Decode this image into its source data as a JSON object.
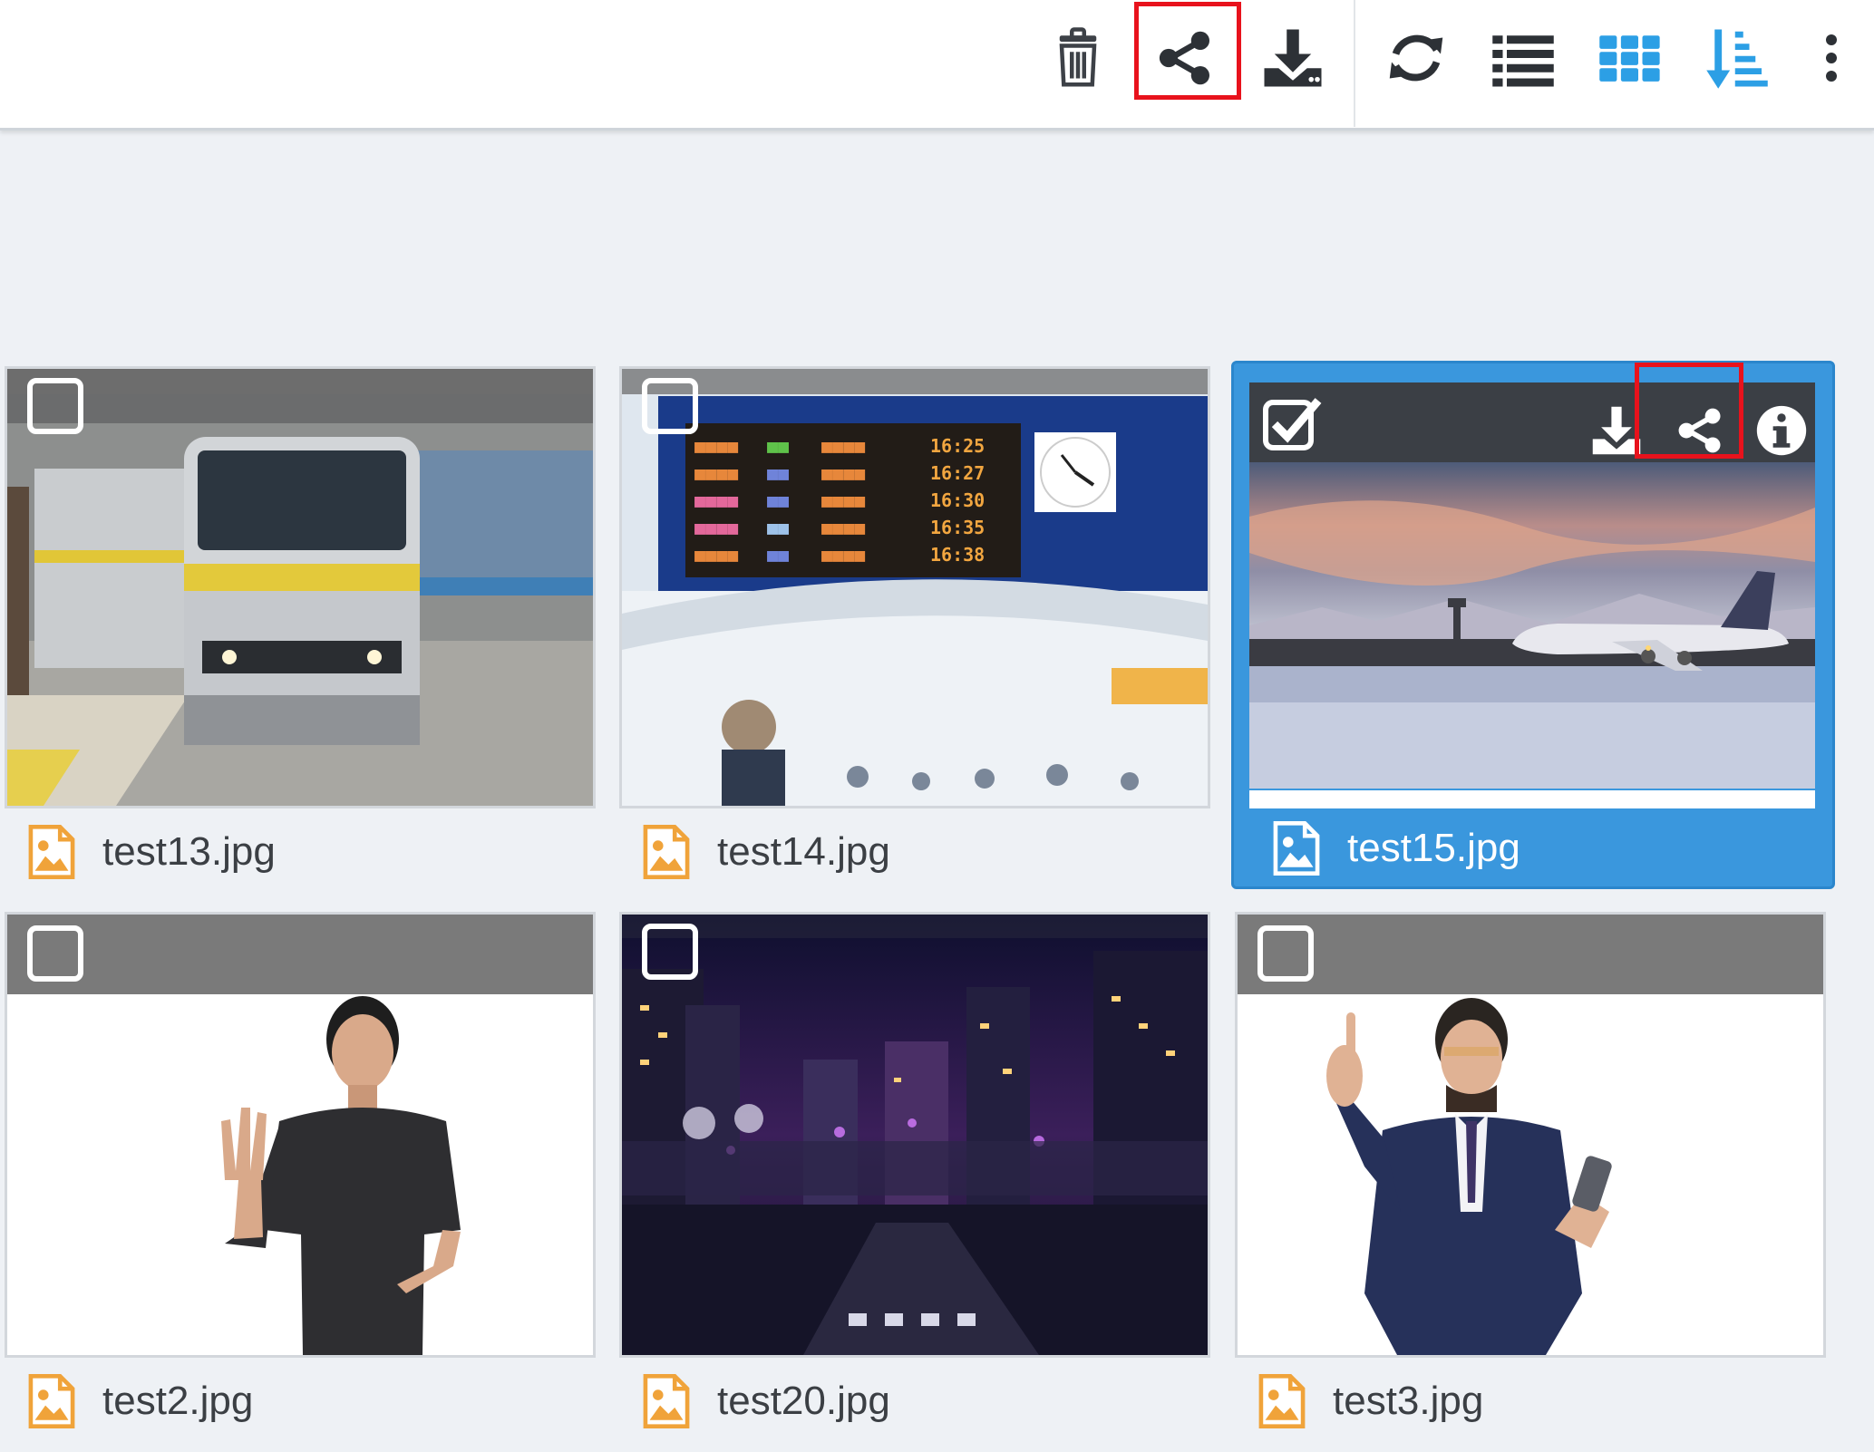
{
  "toolbar": {
    "icons": [
      "trash-icon",
      "share-icon",
      "download-icon",
      "refresh-icon",
      "list-view-icon",
      "grid-view-icon",
      "sort-icon",
      "more-vertical-icon"
    ],
    "accent": "#2c9fe5",
    "highlight": "#e8121c"
  },
  "files": [
    {
      "name": "test13.jpg",
      "selected": false
    },
    {
      "name": "test14.jpg",
      "selected": false
    },
    {
      "name": "test15.jpg",
      "selected": true
    },
    {
      "name": "test2.jpg",
      "selected": false
    },
    {
      "name": "test20.jpg",
      "selected": false
    },
    {
      "name": "test3.jpg",
      "selected": false
    }
  ],
  "colors": {
    "selection": "#3a97dd",
    "file_icon": "#f0a33a",
    "background": "#eef1f5"
  }
}
